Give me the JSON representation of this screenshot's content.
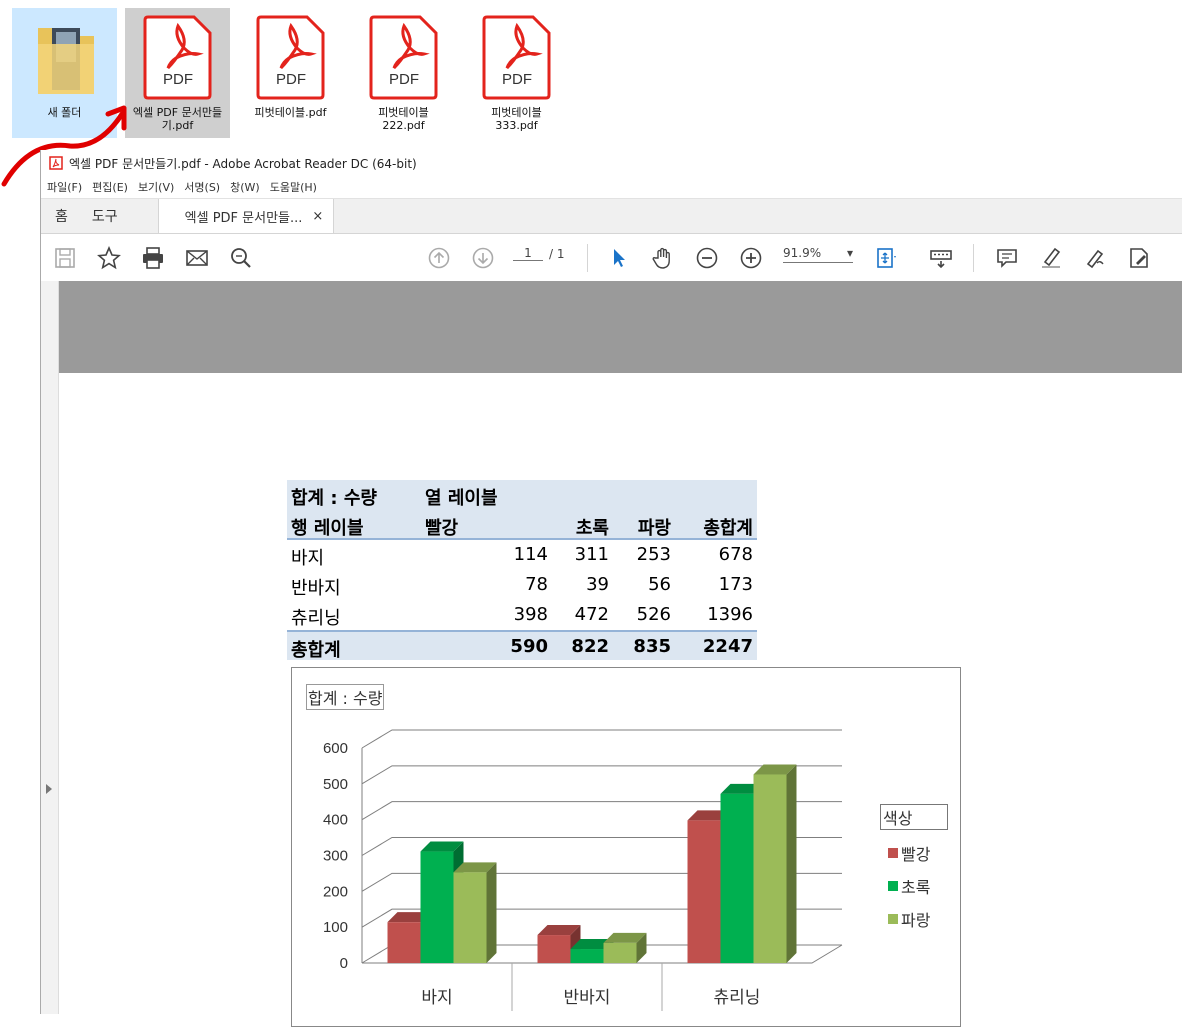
{
  "desktop": {
    "icons": [
      {
        "label": "새 폴더",
        "type": "folder"
      },
      {
        "label": "엑셀 PDF 문서만들기.pdf",
        "type": "pdf",
        "selected": true
      },
      {
        "label": "피벗테이블.pdf",
        "type": "pdf"
      },
      {
        "label": "피벗테이블222.pdf",
        "type": "pdf"
      },
      {
        "label": "피벗테이블333.pdf",
        "type": "pdf"
      }
    ],
    "pdf_badge": "PDF",
    "pdf_color": "#e3231c"
  },
  "window": {
    "title": "엑셀 PDF 문서만들기.pdf - Adobe Acrobat Reader DC (64-bit)",
    "menu": [
      "파일(F)",
      "편집(E)",
      "보기(V)",
      "서명(S)",
      "창(W)",
      "도움말(H)"
    ],
    "tabs": {
      "home": "홈",
      "tools": "도구",
      "document": "엑셀 PDF 문서만들...",
      "close": "×"
    },
    "toolbar": {
      "page_current": "1",
      "page_total": "/ 1",
      "zoom": "91.9%"
    }
  },
  "pivot": {
    "header1": {
      "label": "합계 : 수량",
      "col_label": "열 레이블"
    },
    "header2": {
      "row_label": "행 레이블",
      "cols": [
        "빨강",
        "초록",
        "파랑",
        "총합계"
      ]
    },
    "rows": [
      {
        "name": "바지",
        "values": [
          "114",
          "311",
          "253",
          "678"
        ]
      },
      {
        "name": "반바지",
        "values": [
          "78",
          "39",
          "56",
          "173"
        ]
      },
      {
        "name": "츄리닝",
        "values": [
          "398",
          "472",
          "526",
          "1396"
        ]
      }
    ],
    "total": {
      "name": "총합계",
      "values": [
        "590",
        "822",
        "835",
        "2247"
      ]
    }
  },
  "chart_data": {
    "type": "bar",
    "title": "합계 : 수량",
    "categories": [
      "바지",
      "반바지",
      "츄리닝"
    ],
    "series": [
      {
        "name": "빨강",
        "values": [
          114,
          78,
          398
        ],
        "color": "#c0504d"
      },
      {
        "name": "초록",
        "values": [
          311,
          39,
          472
        ],
        "color": "#00b050"
      },
      {
        "name": "파랑",
        "values": [
          253,
          56,
          526
        ],
        "color": "#9bbb59"
      }
    ],
    "ylim": [
      0,
      600
    ],
    "yticks": [
      "0",
      "100",
      "200",
      "300",
      "400",
      "500",
      "600"
    ],
    "legend_title": "색상",
    "legend": "right",
    "grid": true
  }
}
